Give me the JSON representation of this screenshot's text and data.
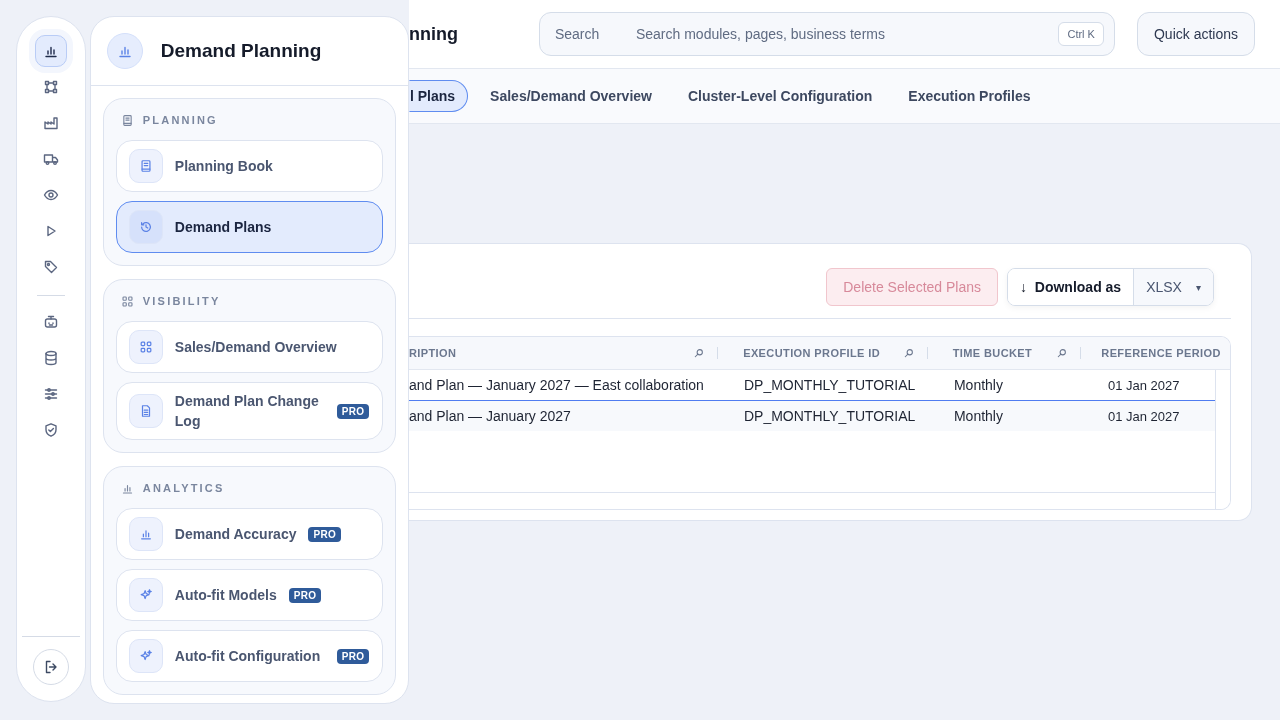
{
  "rail": {
    "items": [
      {
        "selected": true
      },
      {
        "selected": false
      },
      {
        "selected": false
      },
      {
        "selected": false
      },
      {
        "selected": false
      },
      {
        "selected": false
      },
      {
        "selected": false
      }
    ],
    "tools": [
      {
        "selected": false
      },
      {
        "selected": false
      },
      {
        "selected": false
      },
      {
        "selected": false
      }
    ]
  },
  "flyout": {
    "title": "Demand Planning",
    "sections": [
      {
        "title": "PLANNING",
        "items": [
          {
            "label": "Planning Book",
            "selected": false
          },
          {
            "label": "Demand Plans",
            "selected": true
          }
        ]
      },
      {
        "title": "VISIBILITY",
        "items": [
          {
            "label": "Sales/Demand Overview",
            "selected": false
          },
          {
            "label": "Demand Plan Change Log",
            "badge": "PRO",
            "selected": false
          }
        ]
      },
      {
        "title": "ANALYTICS",
        "items": [
          {
            "label": "Demand Accuracy",
            "badge": "PRO",
            "selected": false
          },
          {
            "label": "Auto-fit Models",
            "badge": "PRO",
            "selected": false
          },
          {
            "label": "Auto-fit Configuration",
            "badge": "PRO",
            "selected": false
          }
        ]
      }
    ]
  },
  "header": {
    "title": "nning",
    "search": {
      "label": "Search",
      "placeholder": "Search modules, pages, business terms",
      "shortcut": "Ctrl K"
    },
    "quick_actions": "Quick actions"
  },
  "tabs": [
    {
      "label": "l Plans",
      "selected": true
    },
    {
      "label": "Sales/Demand Overview",
      "selected": false
    },
    {
      "label": "Cluster-Level Configuration",
      "selected": false
    },
    {
      "label": "Execution Profiles",
      "selected": false
    }
  ],
  "toolbar": {
    "delete": {
      "label": "Delete Selected Plans",
      "disabled": true
    },
    "download": {
      "arrow": "↓",
      "label": "Download as",
      "format": "XLSX",
      "caret": "▾"
    }
  },
  "table": {
    "columns": [
      {
        "label": "RIPTION",
        "filterable": true
      },
      {
        "label": "EXECUTION PROFILE ID",
        "filterable": true
      },
      {
        "label": "TIME BUCKET",
        "filterable": true
      },
      {
        "label": "REFERENCE PERIOD",
        "filterable": false
      }
    ],
    "rows": [
      [
        "and Plan — January 2027 — East collaboration",
        "DP_MONTHLY_TUTORIAL",
        "Monthly",
        "01 Jan 2027"
      ],
      [
        "and Plan — January 2027",
        "DP_MONTHLY_TUTORIAL",
        "Monthly",
        "01 Jan 2027"
      ]
    ]
  }
}
